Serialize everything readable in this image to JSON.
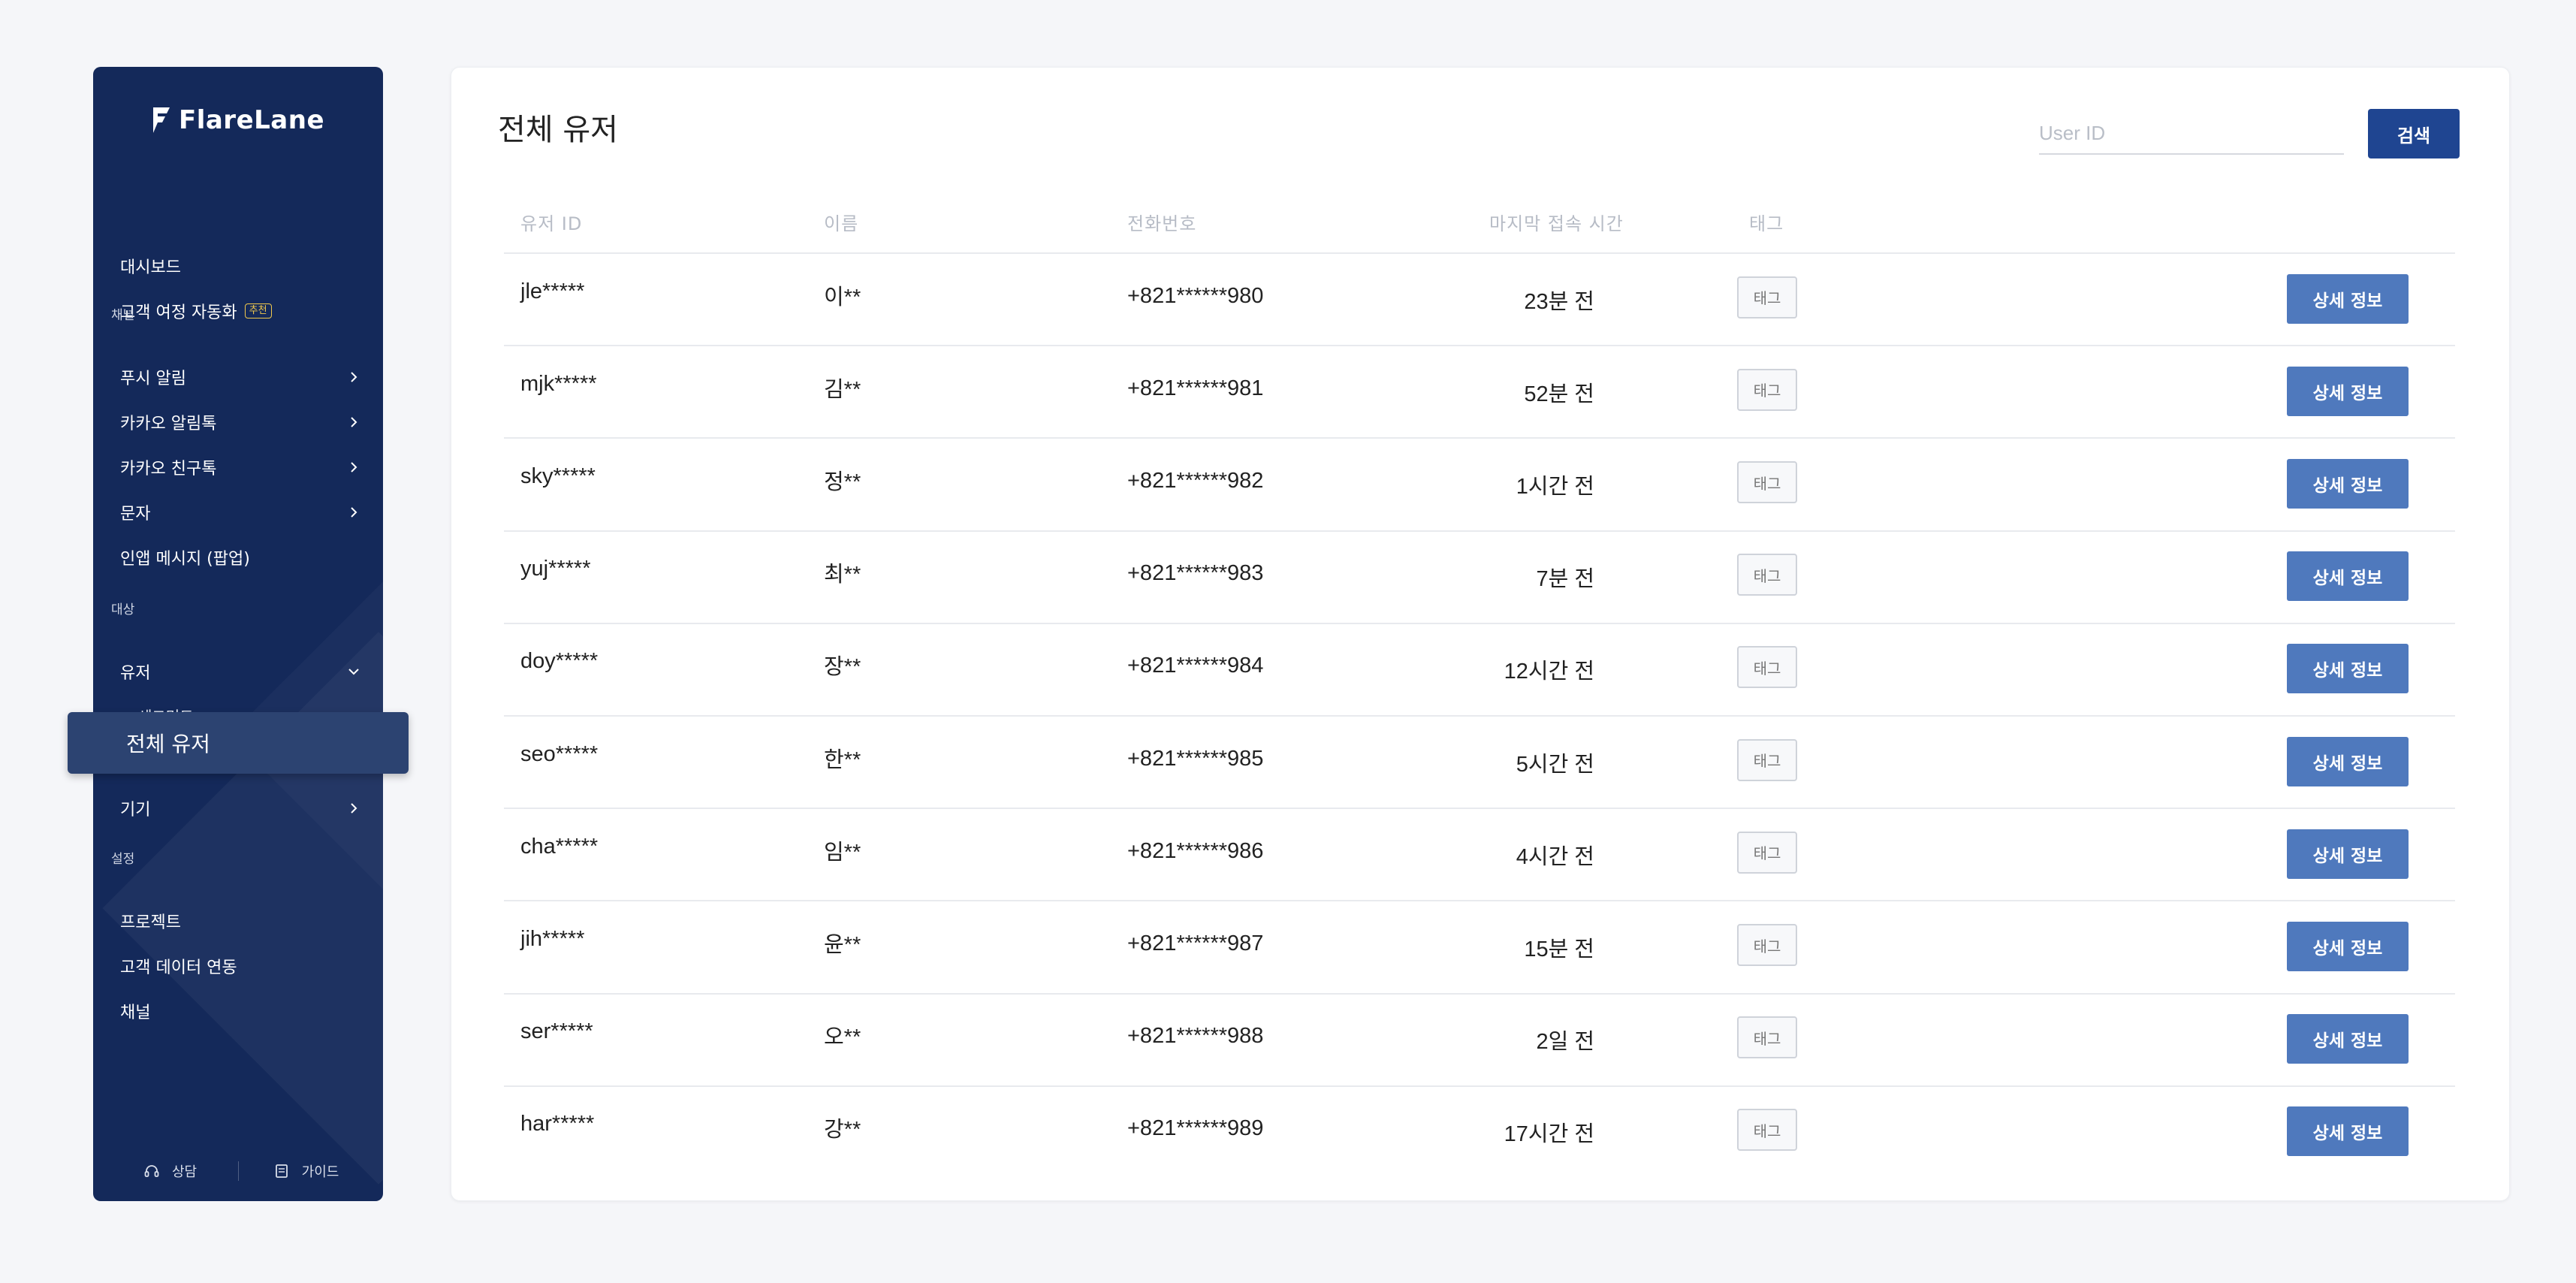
{
  "brand": {
    "name": "FlareLane"
  },
  "sidebar": {
    "top_items": [
      {
        "label": "대시보드"
      },
      {
        "label": "고객 여정 자동화",
        "badge": "추천"
      }
    ],
    "sections": [
      {
        "label": "채널"
      },
      {
        "label": "대상"
      },
      {
        "label": "설정"
      }
    ],
    "channel_items": [
      {
        "label": "푸시 알림"
      },
      {
        "label": "카카오 알림톡"
      },
      {
        "label": "카카오 친구톡"
      },
      {
        "label": "문자"
      },
      {
        "label": "인앱 메시지 (팝업)"
      }
    ],
    "target_items": {
      "users": "유저",
      "segments": "세그먼트",
      "all_users": "전체 유저",
      "devices": "기기"
    },
    "settings_items": [
      {
        "label": "프로젝트"
      },
      {
        "label": "고객 데이터 연동"
      },
      {
        "label": "채널"
      }
    ],
    "footer": {
      "support": "상담",
      "guide": "가이드"
    }
  },
  "main": {
    "title": "전체 유저",
    "search": {
      "placeholder": "User ID",
      "value": "",
      "button_label": "검색"
    },
    "table": {
      "headers": [
        "유저 ID",
        "이름",
        "전화번호",
        "마지막 접속 시간",
        "태그"
      ],
      "tag_label": "태그",
      "detail_label": "상세 정보",
      "rows": [
        {
          "id": "jle*****",
          "name": "이**",
          "phone": "+821******980",
          "last": "23분 전"
        },
        {
          "id": "mjk*****",
          "name": "김**",
          "phone": "+821******981",
          "last": "52분 전"
        },
        {
          "id": "sky*****",
          "name": "정**",
          "phone": "+821******982",
          "last": "1시간 전"
        },
        {
          "id": "yuj*****",
          "name": "최**",
          "phone": "+821******983",
          "last": "7분 전"
        },
        {
          "id": "doy*****",
          "name": "장**",
          "phone": "+821******984",
          "last": "12시간 전"
        },
        {
          "id": "seo*****",
          "name": "한**",
          "phone": "+821******985",
          "last": "5시간 전"
        },
        {
          "id": "cha*****",
          "name": "임**",
          "phone": "+821******986",
          "last": "4시간 전"
        },
        {
          "id": "jih*****",
          "name": "윤**",
          "phone": "+821******987",
          "last": "15분 전"
        },
        {
          "id": "ser*****",
          "name": "오**",
          "phone": "+821******988",
          "last": "2일 전"
        },
        {
          "id": "har*****",
          "name": "강**",
          "phone": "+821******989",
          "last": "17시간 전"
        }
      ]
    }
  },
  "colors": {
    "sidebar_bg": "#14295a",
    "primary_button": "#1f4591",
    "detail_button": "#4f79bd",
    "badge": "#f2c94c"
  }
}
